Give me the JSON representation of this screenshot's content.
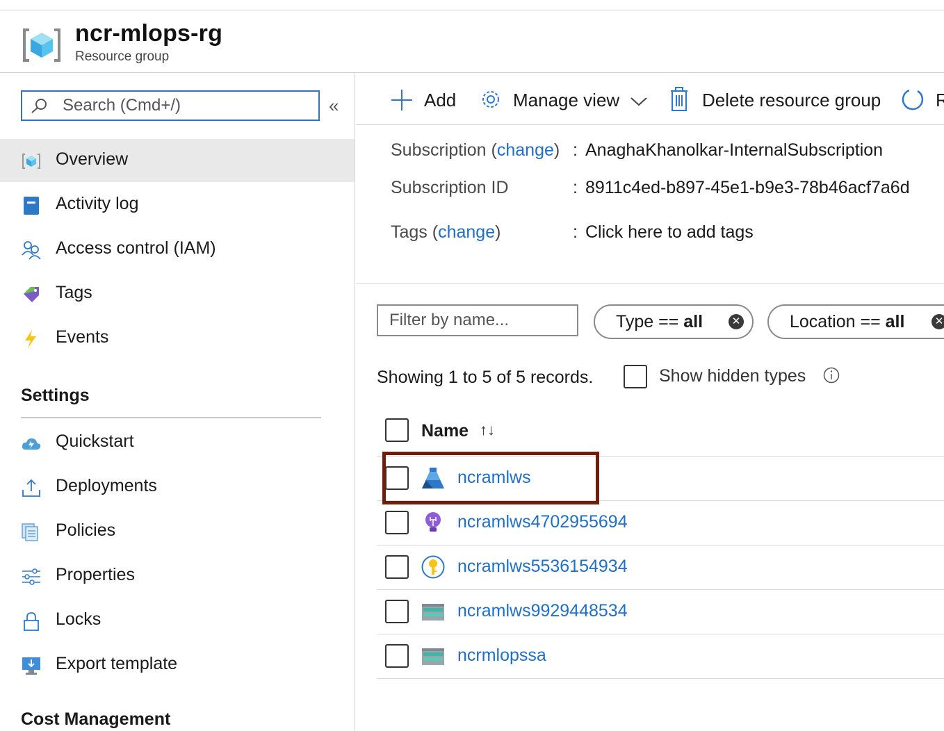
{
  "header": {
    "title": "ncr-mlops-rg",
    "subtitle": "Resource group"
  },
  "sidebar": {
    "search_placeholder": "Search (Cmd+/)",
    "collapse_glyph": "«",
    "items": [
      {
        "label": "Overview",
        "icon": "resource-group-icon",
        "selected": true
      },
      {
        "label": "Activity log",
        "icon": "activity-log-icon"
      },
      {
        "label": "Access control (IAM)",
        "icon": "people-icon"
      },
      {
        "label": "Tags",
        "icon": "tag-icon"
      },
      {
        "label": "Events",
        "icon": "lightning-icon"
      }
    ],
    "settings_heading": "Settings",
    "settings_items": [
      {
        "label": "Quickstart",
        "icon": "cloud-icon"
      },
      {
        "label": "Deployments",
        "icon": "upload-icon"
      },
      {
        "label": "Policies",
        "icon": "policy-icon"
      },
      {
        "label": "Properties",
        "icon": "sliders-icon"
      },
      {
        "label": "Locks",
        "icon": "lock-icon"
      },
      {
        "label": "Export template",
        "icon": "export-icon"
      }
    ],
    "cost_heading": "Cost Management"
  },
  "toolbar": {
    "add_label": "Add",
    "manage_view_label": "Manage view",
    "delete_label": "Delete resource group",
    "refresh_label": "R"
  },
  "essentials": {
    "subscription_label": "Subscription",
    "change_link": "change",
    "subscription_value": "AnaghaKhanolkar-InternalSubscription",
    "subscription_id_label": "Subscription ID",
    "subscription_id_value": "8911c4ed-b897-45e1-b9e3-78b46acf7a6d",
    "tags_label": "Tags",
    "tags_value": "Click here to add tags",
    "colon": ":"
  },
  "filters": {
    "name_placeholder": "Filter by name...",
    "type_prefix": "Type == ",
    "type_value": "all",
    "location_prefix": "Location == ",
    "location_value": "all"
  },
  "records_text": "Showing 1 to 5 of 5 records.",
  "show_hidden_label": "Show hidden types",
  "table": {
    "name_header": "Name",
    "sort_glyph": "↑↓",
    "rows": [
      {
        "name": "ncramlws",
        "icon": "machine-learning-icon"
      },
      {
        "name": "ncramlws4702955694",
        "icon": "app-insights-icon"
      },
      {
        "name": "ncramlws5536154934",
        "icon": "key-vault-icon"
      },
      {
        "name": "ncramlws9929448534",
        "icon": "storage-icon"
      },
      {
        "name": "ncrmlopssa",
        "icon": "storage-icon"
      }
    ]
  },
  "colors": {
    "link": "#1f6fc6",
    "highlight_border": "#6b1f0c",
    "search_border": "#2f74c0",
    "selected_bg": "#e9e9e9"
  }
}
